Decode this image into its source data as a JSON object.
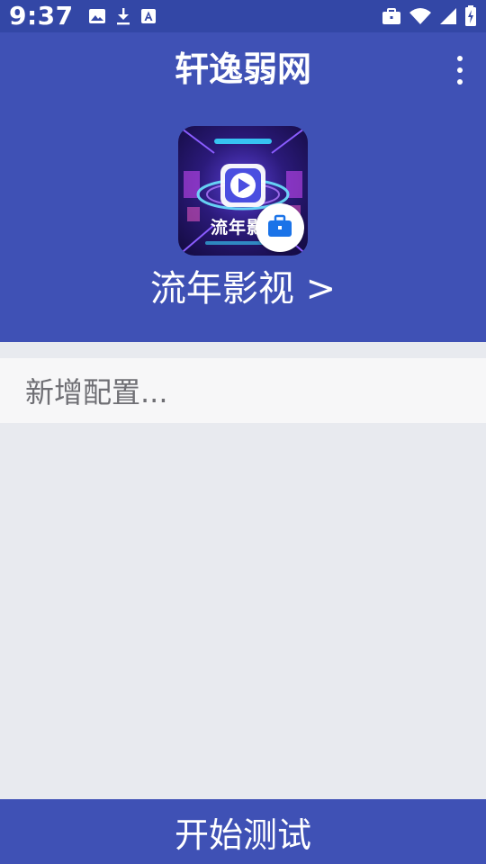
{
  "status_bar": {
    "time": "9:37",
    "left_icons": [
      "image-icon",
      "download-icon",
      "font-a-icon"
    ],
    "right_icons": [
      "work-briefcase-icon",
      "wifi-icon",
      "signal-icon",
      "battery-charging-icon"
    ]
  },
  "app_bar": {
    "title": "轩逸弱网",
    "menu_icon": "more-vert-icon"
  },
  "selected_app": {
    "icon_text": "流年影",
    "name_link": "流年影视 >",
    "badge_icon": "work-briefcase-icon"
  },
  "config": {
    "add_label": "新增配置..."
  },
  "footer": {
    "start_button_label": "开始测试"
  },
  "colors": {
    "status_bar": "#3347a6",
    "primary": "#3f51b5",
    "background": "#e8eaef",
    "row_background": "#f7f7f8",
    "badge_icon": "#1a73e8"
  }
}
